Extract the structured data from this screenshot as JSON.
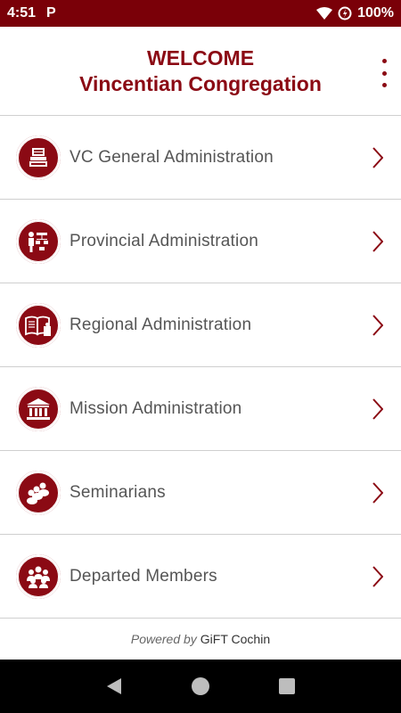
{
  "status_bar": {
    "time": "4:51",
    "app_indicator": "P",
    "battery": "100%",
    "icons": [
      "wifi-icon",
      "data-saver-icon"
    ]
  },
  "header": {
    "title": "WELCOME",
    "subtitle": "Vincentian Congregation",
    "menu_icon": "overflow-menu-icon"
  },
  "menu": {
    "items": [
      {
        "label": "VC General Administration",
        "icon": "cash-register-icon"
      },
      {
        "label": "Provincial Administration",
        "icon": "org-chart-icon"
      },
      {
        "label": "Regional Administration",
        "icon": "book-icon"
      },
      {
        "label": "Mission Administration",
        "icon": "institution-icon"
      },
      {
        "label": "Seminarians",
        "icon": "group-icon"
      },
      {
        "label": "Departed Members",
        "icon": "community-icon"
      }
    ]
  },
  "footer": {
    "powered_by": "Powered by",
    "company": "GiFT Cochin"
  },
  "nav_bar": {
    "buttons": [
      "back-icon",
      "home-icon",
      "recents-icon"
    ]
  },
  "colors": {
    "brand": "#8b0a14",
    "status_bar": "#7a0008"
  }
}
